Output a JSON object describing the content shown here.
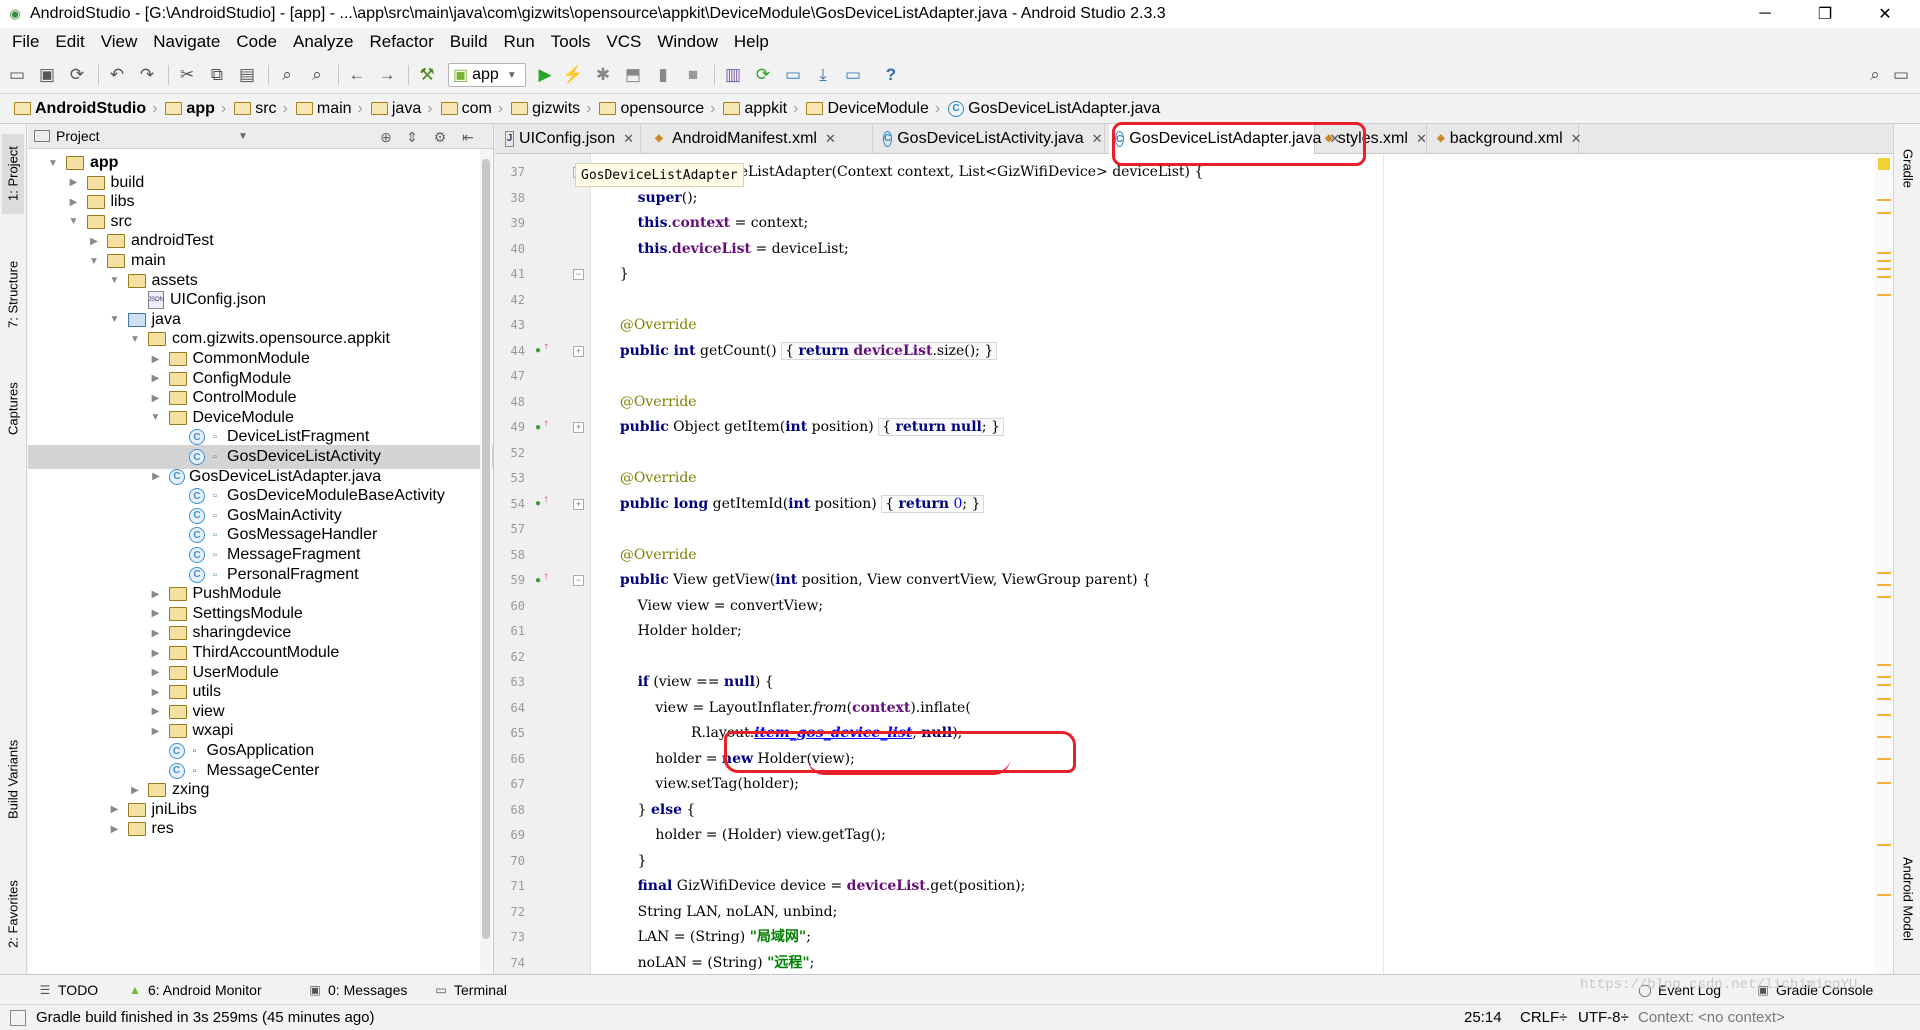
{
  "window": {
    "title": "AndroidStudio - [G:\\AndroidStudio] - [app] - ...\\app\\src\\main\\java\\com\\gizwits\\opensource\\appkit\\DeviceModule\\GosDeviceListAdapter.java - Android Studio 2.3.3",
    "minimize": "─",
    "maximize": "❐",
    "close": "✕"
  },
  "menu": [
    "File",
    "Edit",
    "View",
    "Navigate",
    "Code",
    "Analyze",
    "Refactor",
    "Build",
    "Run",
    "Tools",
    "VCS",
    "Window",
    "Help"
  ],
  "toolbar": {
    "run_config": "app"
  },
  "breadcrumbs": [
    "AndroidStudio",
    "app",
    "src",
    "main",
    "java",
    "com",
    "gizwits",
    "opensource",
    "appkit",
    "DeviceModule",
    "GosDeviceListAdapter.java"
  ],
  "project_panel": {
    "title": "Project",
    "tree": [
      {
        "label": "app",
        "depth": 0,
        "arrow": "▼",
        "icon": "folder",
        "bold": true
      },
      {
        "label": "build",
        "depth": 1,
        "arrow": "▶",
        "icon": "folder"
      },
      {
        "label": "libs",
        "depth": 1,
        "arrow": "▶",
        "icon": "folder"
      },
      {
        "label": "src",
        "depth": 1,
        "arrow": "▼",
        "icon": "folder"
      },
      {
        "label": "androidTest",
        "depth": 2,
        "arrow": "▶",
        "icon": "folder"
      },
      {
        "label": "main",
        "depth": 2,
        "arrow": "▼",
        "icon": "folder"
      },
      {
        "label": "assets",
        "depth": 3,
        "arrow": "▼",
        "icon": "folder"
      },
      {
        "label": "UIConfig.json",
        "depth": 4,
        "arrow": "",
        "icon": "json"
      },
      {
        "label": "java",
        "depth": 3,
        "arrow": "▼",
        "icon": "folder-blue"
      },
      {
        "label": "com.gizwits.opensource.appkit",
        "depth": 4,
        "arrow": "▼",
        "icon": "folder"
      },
      {
        "label": "CommonModule",
        "depth": 5,
        "arrow": "▶",
        "icon": "folder"
      },
      {
        "label": "ConfigModule",
        "depth": 5,
        "arrow": "▶",
        "icon": "folder"
      },
      {
        "label": "ControlModule",
        "depth": 5,
        "arrow": "▶",
        "icon": "folder"
      },
      {
        "label": "DeviceModule",
        "depth": 5,
        "arrow": "▼",
        "icon": "folder"
      },
      {
        "label": "DeviceListFragment",
        "depth": 6,
        "arrow": "",
        "icon": "class"
      },
      {
        "label": "GosDeviceListActivity",
        "depth": 6,
        "arrow": "",
        "icon": "class",
        "selected": true
      },
      {
        "label": "GosDeviceListAdapter.java",
        "depth": 6,
        "arrow": "▶",
        "icon": "class-noLock",
        "arrowOffset": true
      },
      {
        "label": "GosDeviceModuleBaseActivity",
        "depth": 6,
        "arrow": "",
        "icon": "class"
      },
      {
        "label": "GosMainActivity",
        "depth": 6,
        "arrow": "",
        "icon": "class"
      },
      {
        "label": "GosMessageHandler",
        "depth": 6,
        "arrow": "",
        "icon": "class"
      },
      {
        "label": "MessageFragment",
        "depth": 6,
        "arrow": "",
        "icon": "class"
      },
      {
        "label": "PersonalFragment",
        "depth": 6,
        "arrow": "",
        "icon": "class"
      },
      {
        "label": "PushModule",
        "depth": 5,
        "arrow": "▶",
        "icon": "folder"
      },
      {
        "label": "SettingsModule",
        "depth": 5,
        "arrow": "▶",
        "icon": "folder"
      },
      {
        "label": "sharingdevice",
        "depth": 5,
        "arrow": "▶",
        "icon": "folder"
      },
      {
        "label": "ThirdAccountModule",
        "depth": 5,
        "arrow": "▶",
        "icon": "folder"
      },
      {
        "label": "UserModule",
        "depth": 5,
        "arrow": "▶",
        "icon": "folder"
      },
      {
        "label": "utils",
        "depth": 5,
        "arrow": "▶",
        "icon": "folder"
      },
      {
        "label": "view",
        "depth": 5,
        "arrow": "▶",
        "icon": "folder"
      },
      {
        "label": "wxapi",
        "depth": 5,
        "arrow": "▶",
        "icon": "folder"
      },
      {
        "label": "GosApplication",
        "depth": 5,
        "arrow": "",
        "icon": "class"
      },
      {
        "label": "MessageCenter",
        "depth": 5,
        "arrow": "",
        "icon": "class"
      },
      {
        "label": "zxing",
        "depth": 4,
        "arrow": "▶",
        "icon": "folder"
      },
      {
        "label": "jniLibs",
        "depth": 3,
        "arrow": "▶",
        "icon": "folder"
      },
      {
        "label": "res",
        "depth": 3,
        "arrow": "▶",
        "icon": "folder"
      }
    ]
  },
  "left_tool_tabs": [
    "1: Project",
    "7: Structure",
    "Captures",
    "Build Variants",
    "2: Favorites"
  ],
  "right_tool_tabs": [
    "Gradle",
    "Android Model"
  ],
  "editor_tabs": [
    {
      "label": "UIConfig.json",
      "icon": "json"
    },
    {
      "label": "AndroidManifest.xml",
      "icon": "xml"
    },
    {
      "label": "GosDeviceListActivity.java",
      "icon": "class"
    },
    {
      "label": "GosDeviceListAdapter.java",
      "icon": "class",
      "active": true
    },
    {
      "label": "styles.xml",
      "icon": "xml"
    },
    {
      "label": "background.xml",
      "icon": "xml"
    }
  ],
  "editor": {
    "breadcrumb_hint": "GosDeviceListAdapter",
    "lines": [
      {
        "n": "37",
        "html": "    <span class='kw'>public</span> GosDeviceListAdapter(Context context, List&lt;GizWifiDevice&gt; deviceList) {"
      },
      {
        "n": "38",
        "html": "        <span class='kw'>super</span>();"
      },
      {
        "n": "39",
        "html": "        <span class='kw'>this</span>.<span class='fld'>context</span> = context;"
      },
      {
        "n": "40",
        "html": "        <span class='kw'>this</span>.<span class='fld'>deviceList</span> = deviceList;"
      },
      {
        "n": "41",
        "html": "    }"
      },
      {
        "n": "42",
        "html": ""
      },
      {
        "n": "43",
        "html": "    <span class='an'>@Override</span>"
      },
      {
        "n": "44",
        "html": "    <span class='kw'>public int</span> getCount() <span class='fbox'>{ <span class='kw'>return</span> <span class='fld'>deviceList</span>.size(); }</span>"
      },
      {
        "n": "47",
        "html": ""
      },
      {
        "n": "48",
        "html": "    <span class='an'>@Override</span>"
      },
      {
        "n": "49",
        "html": "    <span class='kw'>public</span> Object getItem(<span class='kw'>int</span> position) <span class='fbox'>{ <span class='kw'>return null</span>; }</span>"
      },
      {
        "n": "52",
        "html": ""
      },
      {
        "n": "53",
        "html": "    <span class='an'>@Override</span>"
      },
      {
        "n": "54",
        "html": "    <span class='kw'>public long</span> getItemId(<span class='kw'>int</span> position) <span class='fbox'>{ <span class='kw'>return</span> <span class='num'>0</span>; }</span>"
      },
      {
        "n": "57",
        "html": ""
      },
      {
        "n": "58",
        "html": "    <span class='an'>@Override</span>"
      },
      {
        "n": "59",
        "html": "    <span class='kw'>public</span> View getView(<span class='kw'>int</span> position, View convertView, ViewGroup parent) {"
      },
      {
        "n": "60",
        "html": "        View view = convertView;"
      },
      {
        "n": "61",
        "html": "        Holder holder;"
      },
      {
        "n": "62",
        "html": ""
      },
      {
        "n": "63",
        "html": "        <span class='kw'>if</span> (view == <span class='kw'>null</span>) {"
      },
      {
        "n": "64",
        "html": "            view = LayoutInflater.<span class='itl'>from</span>(<span class='fld'>context</span>).inflate("
      },
      {
        "n": "65",
        "html": "                    R.layout.<span class='lnk'>item_gos_device_list</span>, <span class='kw'>null</span>);"
      },
      {
        "n": "66",
        "html": "            holder = <span class='kw'>new</span> Holder(view);"
      },
      {
        "n": "67",
        "html": "            view.setTag(holder);"
      },
      {
        "n": "68",
        "html": "        } <span class='kw'>else</span> {"
      },
      {
        "n": "69",
        "html": "            holder = (Holder) view.getTag();"
      },
      {
        "n": "70",
        "html": "        }"
      },
      {
        "n": "71",
        "html": "        <span class='kw'>final</span> GizWifiDevice device = <span class='fld'>deviceList</span>.get(position);"
      },
      {
        "n": "72",
        "html": "        String LAN, noLAN, unbind;"
      },
      {
        "n": "73",
        "html": "        LAN = (String) <span class='str'>\"局域网\"</span>;"
      },
      {
        "n": "74",
        "html": "        noLAN = (String) <span class='str'>\"远程\"</span>;"
      }
    ]
  },
  "bottom_tools": {
    "todo": "TODO",
    "android_monitor": "6: Android Monitor",
    "messages": "0: Messages",
    "terminal": "Terminal",
    "event_log": "Event Log",
    "gradle_console": "Gradle Console"
  },
  "status": {
    "message": "Gradle build finished in 3s 259ms (45 minutes ago)",
    "position": "25:14",
    "line_sep": "CRLF÷",
    "encoding": "UTF-8÷",
    "context": "Context: <no context>",
    "watermark": "https://blog.csdn.net/lichimingYU"
  },
  "colors": {
    "annotation": "#e8202a",
    "selection": "#d4d4d4",
    "keyword": "#000080"
  }
}
